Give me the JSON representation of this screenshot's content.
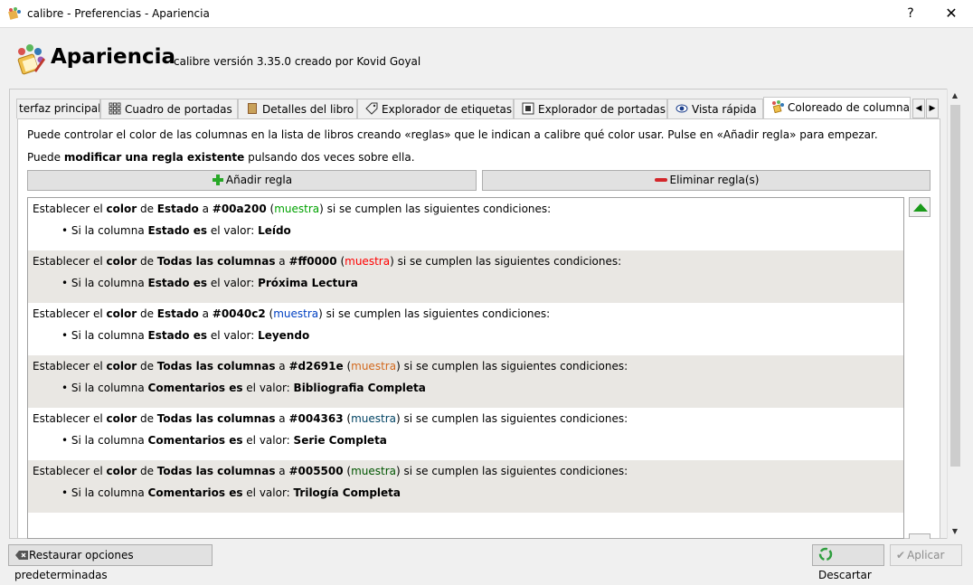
{
  "window": {
    "title": "calibre - Preferencias - Apariencia",
    "help_label": "?",
    "close_label": "✕"
  },
  "header": {
    "title": "Apariencia",
    "subtitle": "calibre versión 3.35.0 creado por Kovid Goyal"
  },
  "tabs": [
    {
      "label": "terfaz principal"
    },
    {
      "label": "Cuadro de portadas"
    },
    {
      "label": "Detalles del libro"
    },
    {
      "label": "Explorador de etiquetas"
    },
    {
      "label": "Explorador de portadas"
    },
    {
      "label": "Vista rápida"
    },
    {
      "label": "Coloreado de columna"
    }
  ],
  "intro": {
    "line1": "Puede controlar el color de las columnas en la lista de libros creando «reglas» que le indican a calibre qué color usar. Pulse en «Añadir regla» para empezar.",
    "line2_pre": "Puede ",
    "line2_bold": "modificar una regla existente",
    "line2_post": " pulsando dos veces sobre ella."
  },
  "buttons": {
    "add_rule": "Añadir regla",
    "remove_rule": "Eliminar regla(s)",
    "restore": "Restaurar opciones predeterminadas",
    "discard": "Descartar",
    "apply": "Aplicar"
  },
  "rule_text": {
    "establish": "Establecer el ",
    "color": "color",
    "de": " de ",
    "a": " a ",
    "sample": "muestra",
    "conditions": " si se cumplen las siguientes condiciones:",
    "bullet_pre": "• Si la columna ",
    "es": " es",
    "value": " el valor: "
  },
  "rules": [
    {
      "column": "Estado",
      "color": "#00a200",
      "cond_column": "Estado",
      "value": "Leído"
    },
    {
      "column": "Todas las columnas",
      "color": "#ff0000",
      "cond_column": "Estado",
      "value": "Próxima Lectura"
    },
    {
      "column": "Estado",
      "color": "#0040c2",
      "cond_column": "Estado",
      "value": "Leyendo"
    },
    {
      "column": "Todas las columnas",
      "color": "#d2691e",
      "cond_column": "Comentarios",
      "value": "Bibliografia Completa"
    },
    {
      "column": "Todas las columnas",
      "color": "#004363",
      "cond_column": "Comentarios",
      "value": "Serie Completa"
    },
    {
      "column": "Todas las columnas",
      "color": "#005500",
      "cond_column": "Comentarios",
      "value": "Trilogía Completa"
    }
  ]
}
